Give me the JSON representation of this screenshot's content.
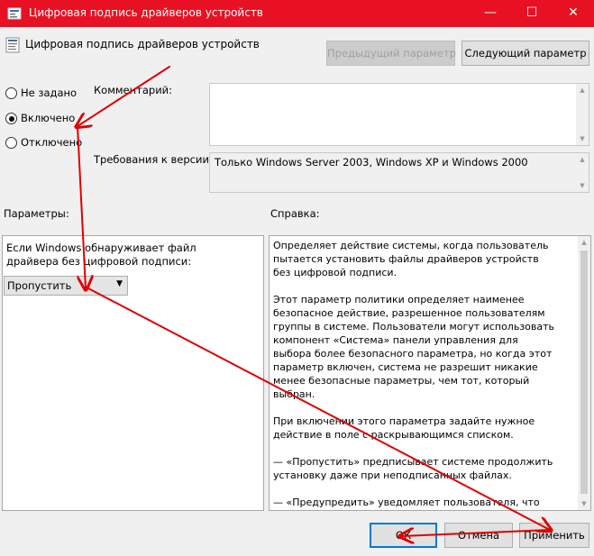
{
  "window": {
    "title": "Цифровая подпись драйверов устройств",
    "minimize_glyph": "—",
    "maximize_glyph": "☐",
    "close_glyph": "✕",
    "titlebar_color": "#e81123"
  },
  "header": {
    "title": "Цифровая подпись драйверов устройств",
    "prev_button": "Предыдущий параметр",
    "next_button": "Следующий параметр"
  },
  "state": {
    "options": [
      {
        "label": "Не задано",
        "selected": false
      },
      {
        "label": "Включено",
        "selected": true
      },
      {
        "label": "Отключено",
        "selected": false
      }
    ]
  },
  "comment": {
    "label": "Комментарий:",
    "value": ""
  },
  "requirements": {
    "label": "Требования к версии:",
    "value": "Только Windows Server 2003, Windows XP и Windows 2000"
  },
  "sections": {
    "params_label": "Параметры:",
    "help_label": "Справка:"
  },
  "params": {
    "description": "Если Windows обнаруживает файл драйвера без цифровой подписи:",
    "dropdown_value": "Пропустить"
  },
  "help": {
    "paragraphs": [
      "Определяет действие системы, когда пользователь пытается установить файлы драйверов устройств без цифровой подписи.",
      "Этот параметр политики определяет наименее безопасное действие, разрешенное пользователям группы в системе. Пользователи могут использовать компонент «Система» панели управления для выбора более безопасного параметра, но когда этот параметр включен, система не разрешит никакие менее безопасные параметры, чем тот, который выбран.",
      "При включении этого параметра задайте нужное действие в поле с раскрывающимся списком.",
      "— «Пропустить» предписывает системе продолжить установку даже при неподписанных файлах.",
      "— «Предупредить» уведомляет пользователя, что файлы не имеют цифровой подписи, и предоставляет пользователю"
    ]
  },
  "footer": {
    "ok": "ОК",
    "cancel": "Отмена",
    "apply": "Применить"
  },
  "annotation_color": "#e00000",
  "icons": [
    "policy-icon",
    "minimize-icon",
    "maximize-icon",
    "close-icon",
    "chevron-down-icon",
    "scroll-up-icon",
    "scroll-down-icon"
  ]
}
